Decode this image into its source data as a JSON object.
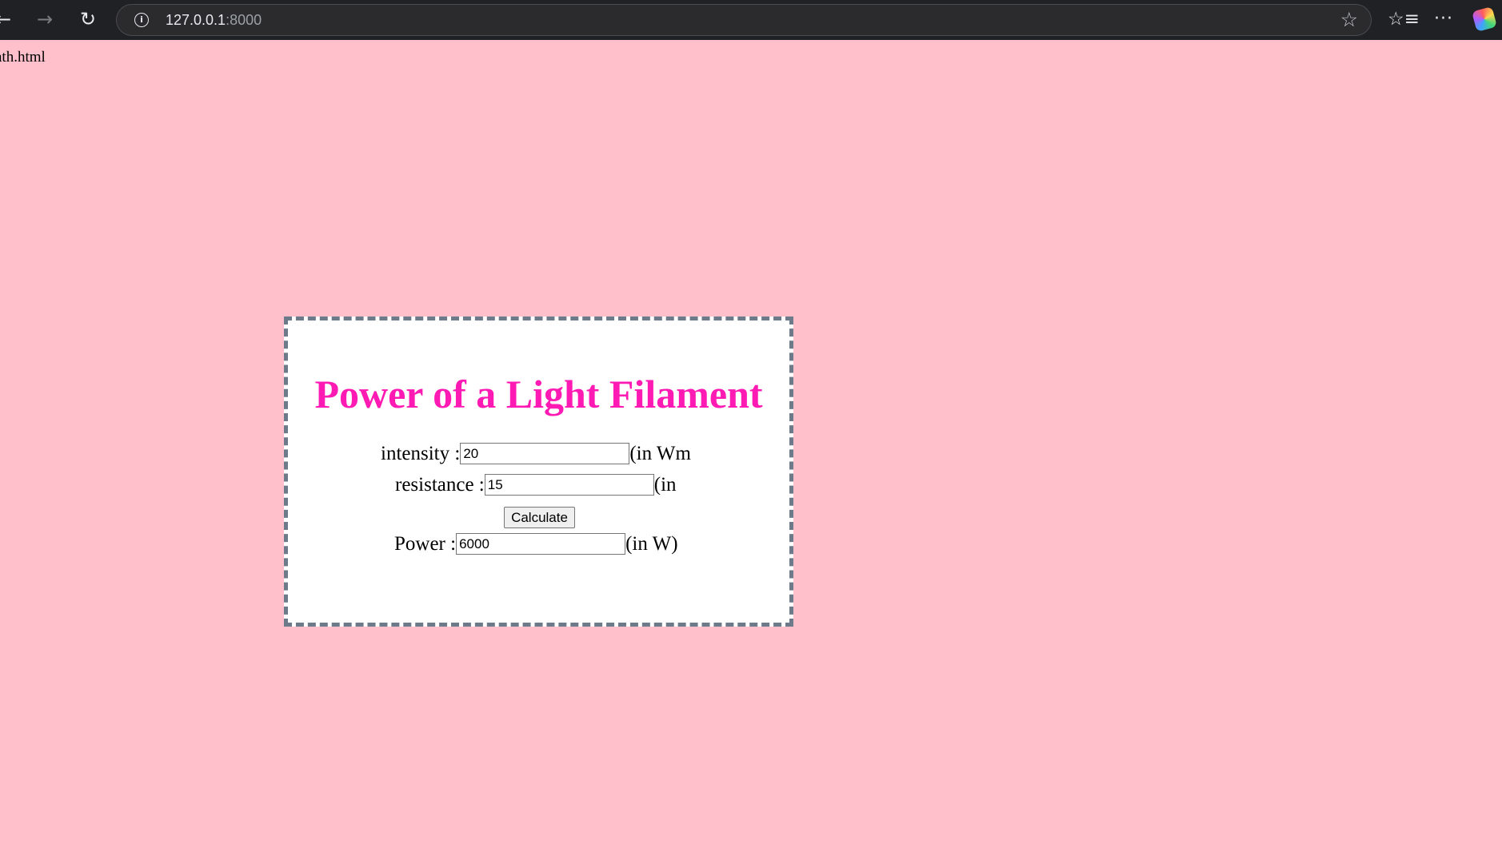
{
  "browser": {
    "back_glyph": "←",
    "forward_glyph": "→",
    "reload_glyph": "↻",
    "info_glyph": "i",
    "url_host": "127.0.0.1",
    "url_port": ":8000",
    "star_glyph": "☆",
    "favorites_glyph": "☆≡",
    "more_glyph": "···"
  },
  "page": {
    "path_text": "ath.html"
  },
  "calculator": {
    "title": "Power of a Light Filament",
    "intensity_label": "intensity : ",
    "intensity_value": "20",
    "intensity_unit": "(in Wm",
    "resistance_label": "resistance : ",
    "resistance_value": "15",
    "resistance_unit": "(in",
    "button_label": "Calculate",
    "power_label": "Power : ",
    "power_value": "6000",
    "power_unit": "(in W)"
  },
  "colors": {
    "page_background": "#ffc0cb",
    "title_color": "#ff1ab3",
    "border_color": "#6d7a8a"
  }
}
